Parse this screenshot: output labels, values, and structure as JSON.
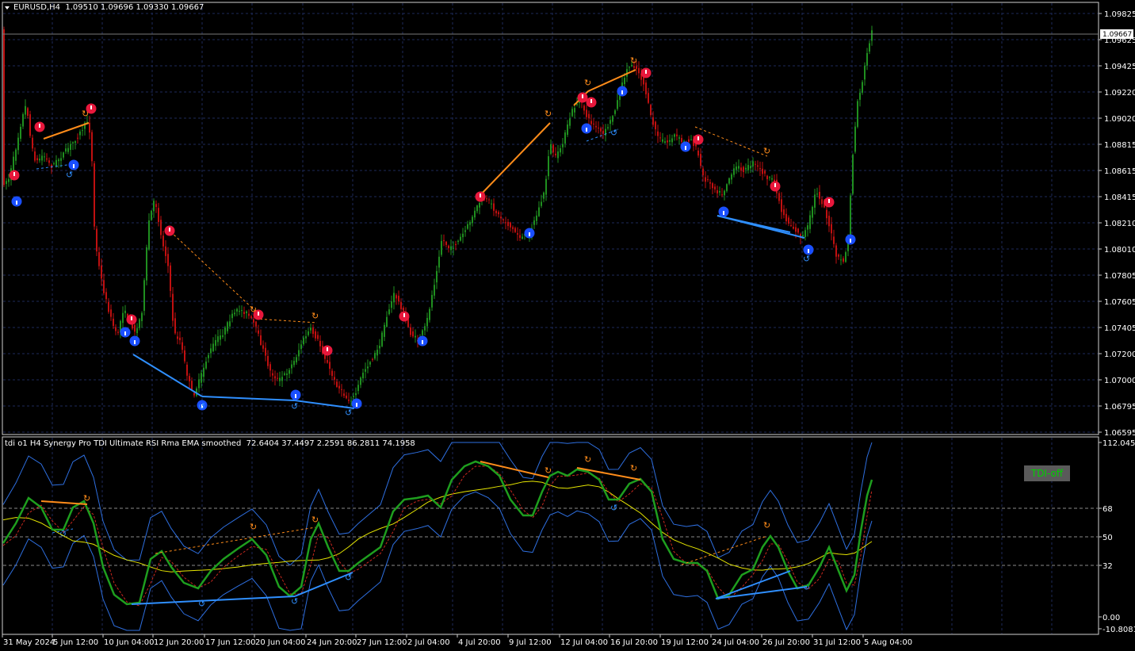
{
  "main_chart": {
    "symbol_label": "EURUSD,H4",
    "ohlc_label": "1.09510 1.09696 1.09330 1.09667",
    "current_price_tag": "1.09667",
    "price_scale": [
      "1.09825",
      "1.09625",
      "1.09425",
      "1.09220",
      "1.09020",
      "1.08815",
      "1.08615",
      "1.08415",
      "1.08210",
      "1.08010",
      "1.07805",
      "1.07605",
      "1.07405",
      "1.07200",
      "1.07000",
      "1.06795",
      "1.06595"
    ]
  },
  "indicator": {
    "title": "tdi o1 H4 Synergy Pro TDI Ultimate RSI Rma EMA smoothed",
    "values": "72.6404 37.4497 2.2591 86.2811 74.1958",
    "scale": [
      "112.0452",
      "68",
      "50",
      "32",
      "0.00",
      "-10.8081"
    ],
    "toggle_label": "TDI-off"
  },
  "time_axis": [
    "31 May 2024",
    "5 Jun 12:00",
    "10 Jun 04:00",
    "12 Jun 20:00",
    "17 Jun 12:00",
    "20 Jun 04:00",
    "24 Jun 20:00",
    "27 Jun 12:00",
    "2 Jul 04:00",
    "4 Jul 20:00",
    "9 Jul 12:00",
    "12 Jul 04:00",
    "16 Jul 20:00",
    "19 Jul 12:00",
    "24 Jul 04:00",
    "26 Jul 20:00",
    "31 Jul 12:00",
    "5 Aug 04:00"
  ],
  "colors": {
    "background": "#000000",
    "grid": "#1e2a5a",
    "bull_candle": "#1f8f1f",
    "bear_candle": "#c01010",
    "bearish_divergence": "#ff8c1a",
    "bullish_divergence": "#2f8fff",
    "sell_marker": "#e8183c",
    "buy_marker": "#1a4fff",
    "tdi_rsi": "#1e9e1e",
    "tdi_signal": "#c8281e",
    "tdi_market_base": "#e6e600",
    "tdi_bands": "#2e6fe0"
  }
}
